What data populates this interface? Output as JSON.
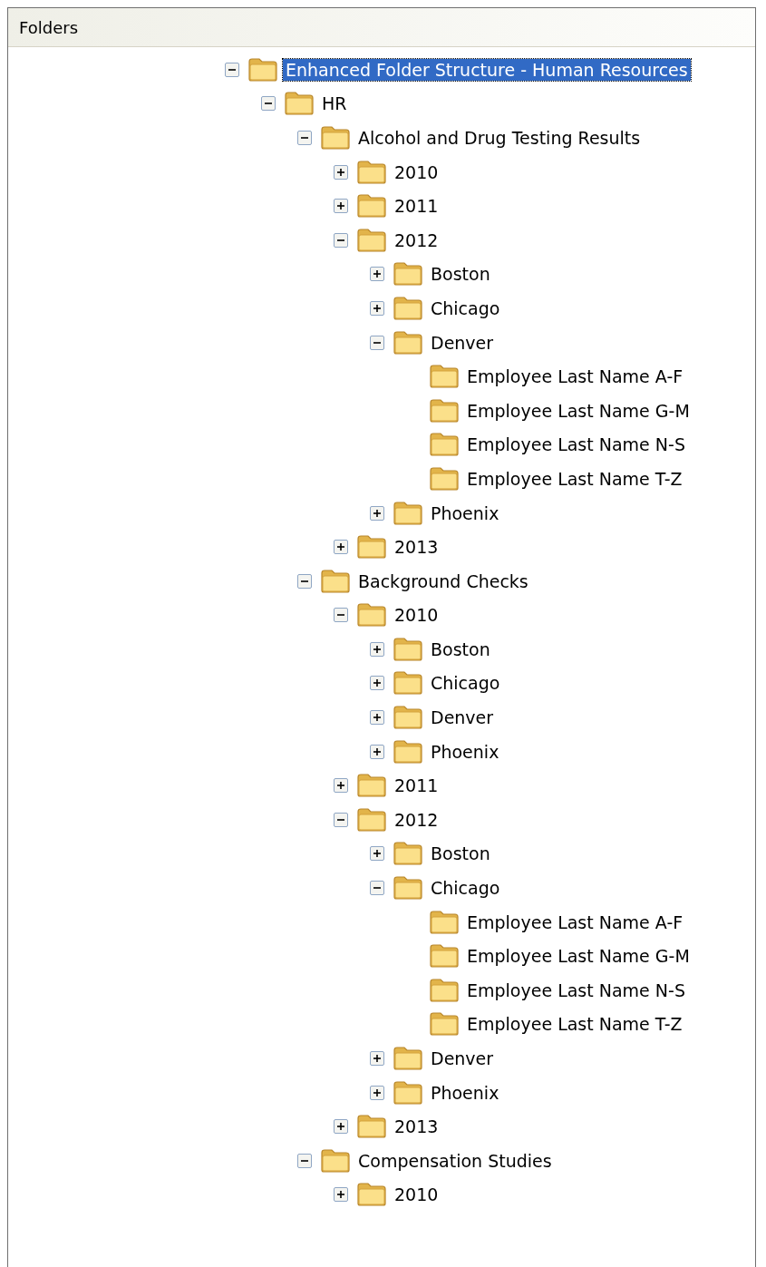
{
  "panel": {
    "title": "Folders"
  },
  "tree": [
    {
      "label": "Enhanced Folder Structure - Human Resources",
      "expanded": true,
      "selected": true,
      "children": [
        {
          "label": "HR",
          "expanded": true,
          "selected": false,
          "children": [
            {
              "label": "Alcohol and Drug Testing Results",
              "expanded": true,
              "selected": false,
              "children": [
                {
                  "label": "2010",
                  "expanded": false,
                  "selected": false
                },
                {
                  "label": "2011",
                  "expanded": false,
                  "selected": false
                },
                {
                  "label": "2012",
                  "expanded": true,
                  "selected": false,
                  "children": [
                    {
                      "label": "Boston",
                      "expanded": false,
                      "selected": false
                    },
                    {
                      "label": "Chicago",
                      "expanded": false,
                      "selected": false
                    },
                    {
                      "label": "Denver",
                      "expanded": true,
                      "selected": false,
                      "children": [
                        {
                          "label": "Employee Last Name A-F",
                          "selected": false
                        },
                        {
                          "label": "Employee Last Name G-M",
                          "selected": false
                        },
                        {
                          "label": "Employee Last Name N-S",
                          "selected": false
                        },
                        {
                          "label": "Employee Last Name T-Z",
                          "selected": false
                        }
                      ]
                    },
                    {
                      "label": "Phoenix",
                      "expanded": false,
                      "selected": false
                    }
                  ]
                },
                {
                  "label": "2013",
                  "expanded": false,
                  "selected": false
                }
              ]
            },
            {
              "label": "Background Checks",
              "expanded": true,
              "selected": false,
              "children": [
                {
                  "label": "2010",
                  "expanded": true,
                  "selected": false,
                  "children": [
                    {
                      "label": "Boston",
                      "expanded": false,
                      "selected": false
                    },
                    {
                      "label": "Chicago",
                      "expanded": false,
                      "selected": false
                    },
                    {
                      "label": "Denver",
                      "expanded": false,
                      "selected": false
                    },
                    {
                      "label": "Phoenix",
                      "expanded": false,
                      "selected": false
                    }
                  ]
                },
                {
                  "label": "2011",
                  "expanded": false,
                  "selected": false
                },
                {
                  "label": "2012",
                  "expanded": true,
                  "selected": false,
                  "children": [
                    {
                      "label": "Boston",
                      "expanded": false,
                      "selected": false
                    },
                    {
                      "label": "Chicago",
                      "expanded": true,
                      "selected": false,
                      "children": [
                        {
                          "label": "Employee Last Name A-F",
                          "selected": false
                        },
                        {
                          "label": "Employee Last Name G-M",
                          "selected": false
                        },
                        {
                          "label": "Employee Last Name N-S",
                          "selected": false
                        },
                        {
                          "label": "Employee Last Name T-Z",
                          "selected": false
                        }
                      ]
                    },
                    {
                      "label": "Denver",
                      "expanded": false,
                      "selected": false
                    },
                    {
                      "label": "Phoenix",
                      "expanded": false,
                      "selected": false
                    }
                  ]
                },
                {
                  "label": "2013",
                  "expanded": false,
                  "selected": false
                }
              ]
            },
            {
              "label": "Compensation Studies",
              "expanded": true,
              "selected": false,
              "children": [
                {
                  "label": "2010",
                  "expanded": false,
                  "selected": false
                }
              ]
            }
          ]
        }
      ]
    }
  ]
}
